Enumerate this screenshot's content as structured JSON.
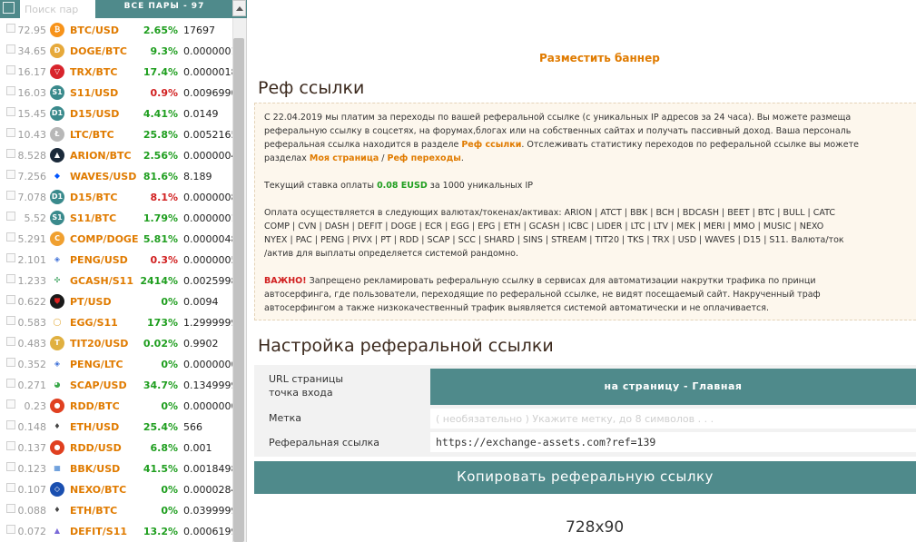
{
  "sidebar": {
    "search_placeholder": "Поиск пар",
    "all_pairs_label": "ВСЕ ПАРЫ - 97",
    "pairs": [
      {
        "prev": "72.95",
        "icon": "bitcoin-icon",
        "icon_text": "₿",
        "icon_color": "#f7931a",
        "name": "BTC/USD",
        "change": "2.65%",
        "dir": "up",
        "value": "17697"
      },
      {
        "prev": "34.65",
        "icon": "dogecoin-icon",
        "icon_text": "Ð",
        "icon_color": "#e6a93b",
        "name": "DOGE/BTC",
        "change": "9.3%",
        "dir": "up",
        "value": "0.0000001"
      },
      {
        "prev": "16.17",
        "icon": "tron-icon",
        "icon_text": "▽",
        "icon_color": "#d8242c",
        "name": "TRX/BTC",
        "change": "17.4%",
        "dir": "up",
        "value": "0.0000018"
      },
      {
        "prev": "16.03",
        "icon": "s11-icon",
        "icon_text": "S1",
        "icon_color": "#3a8a8c",
        "name": "S11/USD",
        "change": "0.9%",
        "dir": "down",
        "value": "0.0096990"
      },
      {
        "prev": "15.45",
        "icon": "d15-icon",
        "icon_text": "D1",
        "icon_color": "#3a8a8c",
        "name": "D15/USD",
        "change": "4.41%",
        "dir": "up",
        "value": "0.0149"
      },
      {
        "prev": "10.43",
        "icon": "litecoin-icon",
        "icon_text": "Ł",
        "icon_color": "#b8b8b8",
        "name": "LTC/BTC",
        "change": "25.8%",
        "dir": "up",
        "value": "0.0052165"
      },
      {
        "prev": "8.528",
        "icon": "arion-icon",
        "icon_text": "▲",
        "icon_color": "#1b2a3a",
        "name": "ARION/BTC",
        "change": "2.56%",
        "dir": "up",
        "value": "0.0000004"
      },
      {
        "prev": "7.256",
        "icon": "waves-icon",
        "icon_text": "◆",
        "icon_color": "#ffffff",
        "icon_fg": "#0055ff",
        "name": "WAVES/USD",
        "change": "81.6%",
        "dir": "up",
        "value": "8.189"
      },
      {
        "prev": "7.078",
        "icon": "d15-icon",
        "icon_text": "D1",
        "icon_color": "#3a8a8c",
        "name": "D15/BTC",
        "change": "8.1%",
        "dir": "down",
        "value": "0.0000008"
      },
      {
        "prev": "5.52",
        "icon": "s11-icon",
        "icon_text": "S1",
        "icon_color": "#3a8a8c",
        "name": "S11/BTC",
        "change": "1.79%",
        "dir": "up",
        "value": "0.0000001"
      },
      {
        "prev": "5.291",
        "icon": "comp-icon",
        "icon_text": "C",
        "icon_color": "#f0a030",
        "name": "COMP/DOGE",
        "change": "5.81%",
        "dir": "up",
        "value": "0.0000048"
      },
      {
        "prev": "2.101",
        "icon": "peng-icon",
        "icon_text": "◈",
        "icon_color": "#ffffff",
        "icon_fg": "#3c6fd8",
        "name": "PENG/USD",
        "change": "0.3%",
        "dir": "down",
        "value": "0.0000005"
      },
      {
        "prev": "1.233",
        "icon": "gcash-icon",
        "icon_text": "✣",
        "icon_color": "#ffffff",
        "icon_fg": "#2a9a50",
        "name": "GCASH/S11",
        "change": "2414%",
        "dir": "up",
        "value": "0.0025998"
      },
      {
        "prev": "0.622",
        "icon": "pt-icon",
        "icon_text": "⛊",
        "icon_color": "#1a1a1a",
        "icon_fg": "#e02020",
        "name": "PT/USD",
        "change": "0%",
        "dir": "zero",
        "value": "0.0094"
      },
      {
        "prev": "0.583",
        "icon": "egg-icon",
        "icon_text": "◯",
        "icon_color": "#ffffff",
        "icon_fg": "#e0a020",
        "name": "EGG/S11",
        "change": "173%",
        "dir": "up",
        "value": "1.2999999"
      },
      {
        "prev": "0.483",
        "icon": "tit20-icon",
        "icon_text": "T",
        "icon_color": "#e0b040",
        "name": "TIT20/USD",
        "change": "0.02%",
        "dir": "up",
        "value": "0.9902"
      },
      {
        "prev": "0.352",
        "icon": "peng-icon",
        "icon_text": "◈",
        "icon_color": "#ffffff",
        "icon_fg": "#3c6fd8",
        "name": "PENG/LTC",
        "change": "0%",
        "dir": "zero",
        "value": "0.0000000"
      },
      {
        "prev": "0.271",
        "icon": "scap-icon",
        "icon_text": "◕",
        "icon_color": "#ffffff",
        "icon_fg": "#3aa84a",
        "name": "SCAP/USD",
        "change": "34.7%",
        "dir": "up",
        "value": "0.1349999"
      },
      {
        "prev": "0.23",
        "icon": "rdd-icon",
        "icon_text": "●",
        "icon_color": "#e04020",
        "name": "RDD/BTC",
        "change": "0%",
        "dir": "zero",
        "value": "0.0000000"
      },
      {
        "prev": "0.148",
        "icon": "ethereum-icon",
        "icon_text": "♦",
        "icon_color": "#ffffff",
        "icon_fg": "#444444",
        "name": "ETH/USD",
        "change": "25.4%",
        "dir": "up",
        "value": "566"
      },
      {
        "prev": "0.137",
        "icon": "rdd-icon",
        "icon_text": "●",
        "icon_color": "#e04020",
        "name": "RDD/USD",
        "change": "6.8%",
        "dir": "up",
        "value": "0.001"
      },
      {
        "prev": "0.123",
        "icon": "bbk-icon",
        "icon_text": "▦",
        "icon_color": "#ffffff",
        "icon_fg": "#3c7fd0",
        "name": "BBK/USD",
        "change": "41.5%",
        "dir": "up",
        "value": "0.0018498"
      },
      {
        "prev": "0.107",
        "icon": "nexo-icon",
        "icon_text": "◇",
        "icon_color": "#1a4fb0",
        "name": "NEXO/BTC",
        "change": "0%",
        "dir": "zero",
        "value": "0.0000284"
      },
      {
        "prev": "0.088",
        "icon": "ethereum-icon",
        "icon_text": "♦",
        "icon_color": "#ffffff",
        "icon_fg": "#444444",
        "name": "ETH/BTC",
        "change": "0%",
        "dir": "zero",
        "value": "0.0399999"
      },
      {
        "prev": "0.072",
        "icon": "defit-icon",
        "icon_text": "▲",
        "icon_color": "#ffffff",
        "icon_fg": "#7a6ad8",
        "name": "DEFIT/S11",
        "change": "13.2%",
        "dir": "up",
        "value": "0.0006199"
      }
    ]
  },
  "main": {
    "banner_link": "Разместить баннер",
    "ref_title": "Реф ссылки",
    "info": {
      "line1_a": "С 22.04.2019 мы платим за переходы по вашей реферальной ссылке (с уникальных IP адресов за 24 часа). Вы можете размеща",
      "line2": "реферальную ссылку в соцсетях, на форумах,блогах или на собственных сайтах и получать пассивный доход. Ваша персональ",
      "line3_a": "реферальная ссылка находится в разделе ",
      "line3_link": "Реф ссылки",
      "line3_b": ". Отслеживать статистику переходов по реферальной ссылке вы можете",
      "line4_a": "разделах ",
      "line4_link1": "Моя страница",
      "line4_sep": " / ",
      "line4_link2": "Реф переходы",
      "line4_b": ".",
      "rate_a": "Текущий ставка оплаты ",
      "rate_value": "0.08 EUSD",
      "rate_b": " за 1000 уникальных IP",
      "pay1": "Оплата осуществляется в следующих валютах/токенах/активах: ARION | ATCT | BBK | BCH | BDCASH | BEET | BTC | BULL | CATC",
      "pay2": "COMP | CVN | DASH | DEFIT | DOGE | ECR | EGG | EPG | ETH | GCASH | ICBC | LIDER | LTC | LTV | MEK | MERI | MMO | MUSIC | NEXO",
      "pay3": "NYEX | PAC | PENG | PIVX | PT | RDD | SCAP | SCC | SHARD | SINS | STREAM | TIT20 | TKS | TRX | USD | WAVES | D15 | S11. Валюта/ток",
      "pay4": "/актив для выплаты определяется системой рандомно.",
      "warn_label": "ВАЖНО!",
      "warn1": " Запрещено рекламировать реферальную ссылку в сервисах для автоматизации накрутки трафика по принци",
      "warn2": "автосерфинга, где пользователи, переходящие по реферальной ссылке, не видят посещаемый сайт. Накрученный траф",
      "warn3": "автосерфингом а также низкокачественный трафик выявляется системой автоматически и не оплачивается."
    },
    "setup_title": "Настройка реферальной ссылки",
    "form": {
      "url_label_1": "URL страницы",
      "url_label_2": "точка входа",
      "page_select": "на страницу - Главная",
      "tag_label": "Метка",
      "tag_placeholder": "( необязательно ) Укажите метку, до 8 символов . . .",
      "ref_label": "Реферальная ссылка",
      "ref_value": "https://exchange-assets.com?ref=139"
    },
    "copy_button": "Копировать реферальную ссылку",
    "banner_size": "728x90"
  }
}
